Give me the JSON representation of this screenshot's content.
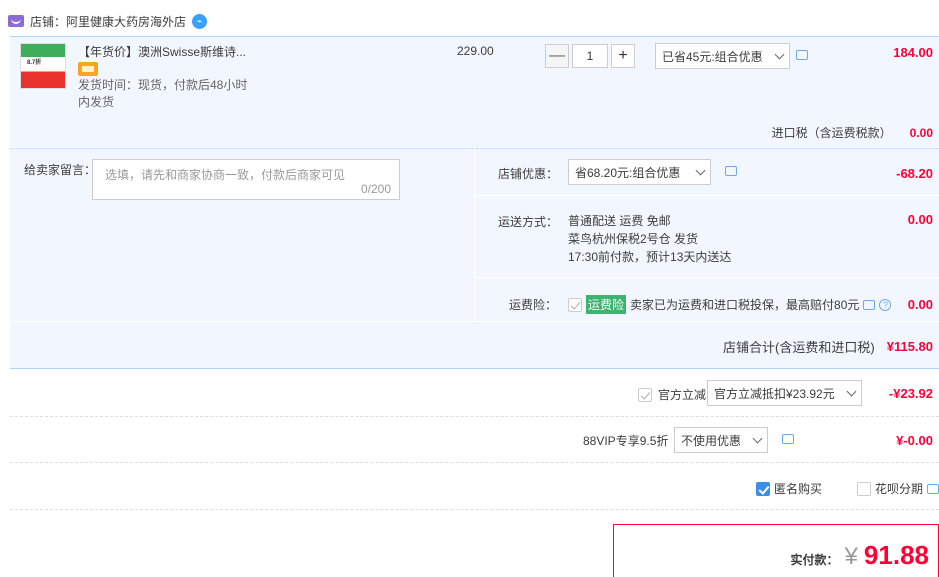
{
  "shop": {
    "label": "店铺：",
    "name": "阿里健康大药房海外店"
  },
  "item": {
    "thumb_text": "8.7折",
    "title": "【年货价】澳洲Swisse斯维诗...",
    "shipping_time": "发货时间：现货，付款后48小时内发货",
    "unit_price": "229.00",
    "quantity": "1",
    "minus": "—",
    "plus": "+",
    "discount_select": "已省45元:组合优惠",
    "subtotal": "184.00"
  },
  "import_tax": {
    "label": "进口税（含运费税款）",
    "value": "0.00"
  },
  "memo": {
    "label": "给卖家留言：",
    "placeholder": "选填，请先和商家协商一致，付款后商家可见",
    "counter": "0/200"
  },
  "shop_discount": {
    "label": "店铺优惠：",
    "select": "省68.20元:组合优惠",
    "value": "-68.20"
  },
  "delivery": {
    "label": "运送方式：",
    "line1": "普通配送 运费 免邮",
    "line2": "菜鸟杭州保税2号仓   发货",
    "line3": "17:30前付款，预计13天内送达",
    "value": "0.00"
  },
  "insurance": {
    "label": "运费险：",
    "badge": "运费险",
    "text": "卖家已为运费和进口税投保，最高赔付80元",
    "value": "0.00"
  },
  "shop_total": {
    "label": "店铺合计(含运费和进口税)",
    "value": "¥115.80"
  },
  "official": {
    "label": "官方立减",
    "select": "官方立减抵扣¥23.92元",
    "value": "-¥23.92"
  },
  "vip": {
    "label": "88VIP专享9.5折",
    "select": "不使用优惠",
    "value": "¥-0.00"
  },
  "options": {
    "anonymous": "匿名购买",
    "huabei": "花呗分期"
  },
  "payment": {
    "label": "实付款：",
    "currency": "¥",
    "amount": "91.88"
  },
  "colors": {
    "accent_red": "#ff0036",
    "panel_bg": "#f2f7ff",
    "checkbox_blue": "#3d8ee6"
  }
}
